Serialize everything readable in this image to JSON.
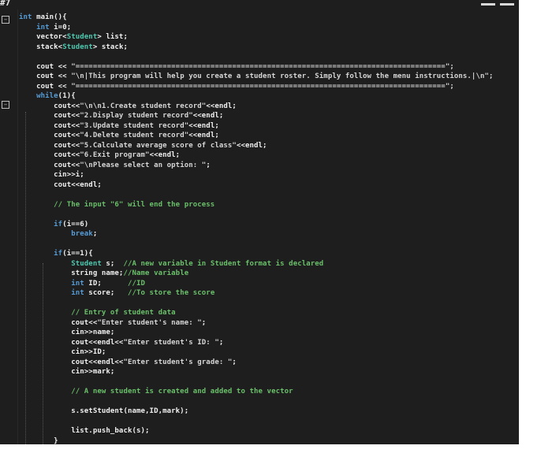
{
  "window": {
    "top_left": "#7",
    "top_right": "...",
    "accent": "#1e1e1e"
  },
  "code": {
    "lines": [
      {
        "segs": [
          {
            "t": "int",
            "c": "kw"
          },
          {
            "t": " main(){",
            "c": ""
          }
        ]
      },
      {
        "segs": [
          {
            "t": "    int",
            "c": "kw"
          },
          {
            "t": " i=0;",
            "c": ""
          }
        ]
      },
      {
        "segs": [
          {
            "t": "    vector<",
            "c": ""
          },
          {
            "t": "Student",
            "c": "ty"
          },
          {
            "t": "> list;",
            "c": ""
          }
        ]
      },
      {
        "segs": [
          {
            "t": "    stack<",
            "c": ""
          },
          {
            "t": "Student",
            "c": "ty"
          },
          {
            "t": "> stack;",
            "c": ""
          }
        ]
      },
      {
        "segs": [
          {
            "t": "",
            "c": ""
          }
        ]
      },
      {
        "segs": [
          {
            "t": "    cout << ",
            "c": ""
          },
          {
            "t": "\"=====================================================================================\";",
            "c": "st"
          }
        ]
      },
      {
        "segs": [
          {
            "t": "    cout << ",
            "c": ""
          },
          {
            "t": "\"\\n|This program will help you create a student roster. Simply follow the menu instructions.|\\n\";",
            "c": "st"
          }
        ]
      },
      {
        "segs": [
          {
            "t": "    cout << ",
            "c": ""
          },
          {
            "t": "\"=====================================================================================\";",
            "c": "st"
          }
        ]
      },
      {
        "segs": [
          {
            "t": "    while",
            "c": "kw"
          },
          {
            "t": "(1){",
            "c": ""
          }
        ]
      },
      {
        "segs": [
          {
            "t": "        cout<<",
            "c": ""
          },
          {
            "t": "\"\\n\\n1.Create student record\"",
            "c": "st"
          },
          {
            "t": "<<endl;",
            "c": ""
          }
        ]
      },
      {
        "segs": [
          {
            "t": "        cout<<",
            "c": ""
          },
          {
            "t": "\"2.Display student record\"",
            "c": "st"
          },
          {
            "t": "<<endl;",
            "c": ""
          }
        ]
      },
      {
        "segs": [
          {
            "t": "        cout<<",
            "c": ""
          },
          {
            "t": "\"3.Update student record\"",
            "c": "st"
          },
          {
            "t": "<<endl;",
            "c": ""
          }
        ]
      },
      {
        "segs": [
          {
            "t": "        cout<<",
            "c": ""
          },
          {
            "t": "\"4.Delete student record\"",
            "c": "st"
          },
          {
            "t": "<<endl;",
            "c": ""
          }
        ]
      },
      {
        "segs": [
          {
            "t": "        cout<<",
            "c": ""
          },
          {
            "t": "\"5.Calculate average score of class\"",
            "c": "st"
          },
          {
            "t": "<<endl;",
            "c": ""
          }
        ]
      },
      {
        "segs": [
          {
            "t": "        cout<<",
            "c": ""
          },
          {
            "t": "\"6.Exit program\"",
            "c": "st"
          },
          {
            "t": "<<endl;",
            "c": ""
          }
        ]
      },
      {
        "segs": [
          {
            "t": "        cout<<",
            "c": ""
          },
          {
            "t": "\"\\nPlease select an option: \"",
            "c": "st"
          },
          {
            "t": ";",
            "c": ""
          }
        ]
      },
      {
        "segs": [
          {
            "t": "        cin>>i;",
            "c": ""
          }
        ]
      },
      {
        "segs": [
          {
            "t": "        cout<<endl;",
            "c": ""
          }
        ]
      },
      {
        "segs": [
          {
            "t": "",
            "c": ""
          }
        ]
      },
      {
        "segs": [
          {
            "t": "        // The input \"6\" will end the process",
            "c": "cm"
          }
        ]
      },
      {
        "segs": [
          {
            "t": "",
            "c": ""
          }
        ]
      },
      {
        "segs": [
          {
            "t": "        if",
            "c": "kw"
          },
          {
            "t": "(i==6)",
            "c": ""
          }
        ]
      },
      {
        "segs": [
          {
            "t": "            break",
            "c": "kw"
          },
          {
            "t": ";",
            "c": ""
          }
        ]
      },
      {
        "segs": [
          {
            "t": "",
            "c": ""
          }
        ]
      },
      {
        "segs": [
          {
            "t": "        if",
            "c": "kw"
          },
          {
            "t": "(i==1){",
            "c": ""
          }
        ]
      },
      {
        "segs": [
          {
            "t": "            ",
            "c": ""
          },
          {
            "t": "Student",
            "c": "ty"
          },
          {
            "t": " s;  ",
            "c": ""
          },
          {
            "t": "//A new variable in Student format is declared",
            "c": "cm"
          }
        ]
      },
      {
        "segs": [
          {
            "t": "            string name;",
            "c": ""
          },
          {
            "t": "//Name variable",
            "c": "cm"
          }
        ]
      },
      {
        "segs": [
          {
            "t": "            int",
            "c": "kw"
          },
          {
            "t": " ID;      ",
            "c": ""
          },
          {
            "t": "//ID",
            "c": "cm"
          }
        ]
      },
      {
        "segs": [
          {
            "t": "            int",
            "c": "kw"
          },
          {
            "t": " score;   ",
            "c": ""
          },
          {
            "t": "//To store the score",
            "c": "cm"
          }
        ]
      },
      {
        "segs": [
          {
            "t": "",
            "c": ""
          }
        ]
      },
      {
        "segs": [
          {
            "t": "            // Entry of student data",
            "c": "cm"
          }
        ]
      },
      {
        "segs": [
          {
            "t": "            cout<<",
            "c": ""
          },
          {
            "t": "\"Enter student's name: \"",
            "c": "st"
          },
          {
            "t": ";",
            "c": ""
          }
        ]
      },
      {
        "segs": [
          {
            "t": "            cin>>name;",
            "c": ""
          }
        ]
      },
      {
        "segs": [
          {
            "t": "            cout<<endl<<",
            "c": ""
          },
          {
            "t": "\"Enter student's ID: \"",
            "c": "st"
          },
          {
            "t": ";",
            "c": ""
          }
        ]
      },
      {
        "segs": [
          {
            "t": "            cin>>ID;",
            "c": ""
          }
        ]
      },
      {
        "segs": [
          {
            "t": "            cout<<endl<<",
            "c": ""
          },
          {
            "t": "\"Enter student's grade: \"",
            "c": "st"
          },
          {
            "t": ";",
            "c": ""
          }
        ]
      },
      {
        "segs": [
          {
            "t": "            cin>>mark;",
            "c": ""
          }
        ]
      },
      {
        "segs": [
          {
            "t": "",
            "c": ""
          }
        ]
      },
      {
        "segs": [
          {
            "t": "            // A new student is created and added to the vector",
            "c": "cm"
          }
        ]
      },
      {
        "segs": [
          {
            "t": "",
            "c": ""
          }
        ]
      },
      {
        "segs": [
          {
            "t": "            s.setStudent(name,ID,mark);",
            "c": ""
          }
        ]
      },
      {
        "segs": [
          {
            "t": "",
            "c": ""
          }
        ]
      },
      {
        "segs": [
          {
            "t": "            list.push_back(s);",
            "c": ""
          }
        ]
      },
      {
        "segs": [
          {
            "t": "        }",
            "c": ""
          }
        ]
      }
    ]
  }
}
